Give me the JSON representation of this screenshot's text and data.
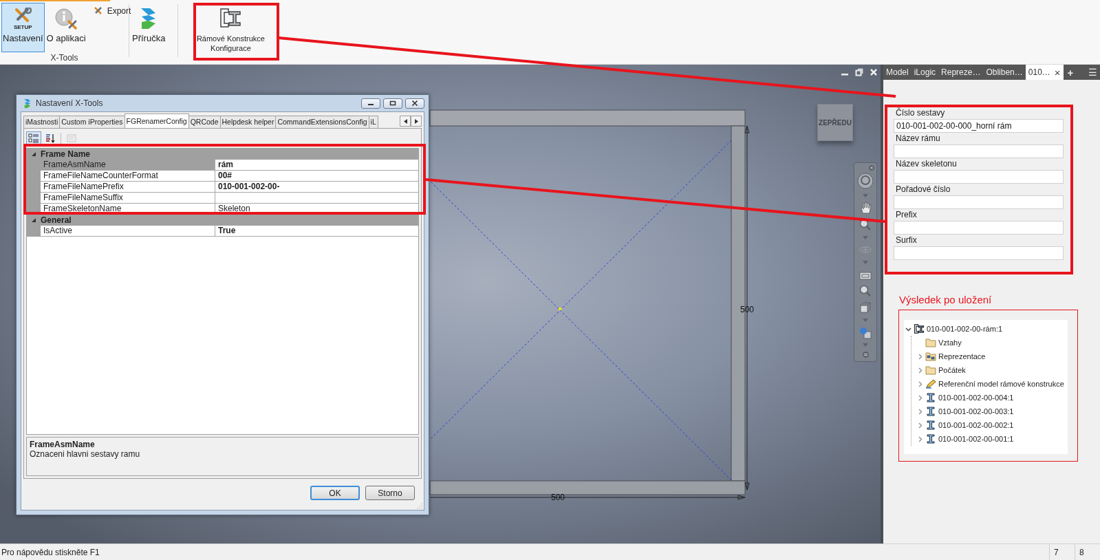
{
  "ribbon": {
    "groups": [
      {
        "label": "X-Tools",
        "buttons": [
          {
            "label": "Nastavení",
            "kind": "setup",
            "icon_caption": "SETUP",
            "selected": true
          },
          {
            "label": "O aplikaci",
            "kind": "about",
            "selected": false
          },
          {
            "label": "Export",
            "kind": "export",
            "selected": false
          }
        ]
      },
      {
        "buttons": [
          {
            "label": "Příručka",
            "kind": "manual",
            "selected": false
          }
        ]
      },
      {
        "buttons": [
          {
            "label": "Rámové Konstrukce Konfigurace",
            "kind": "frame",
            "selected": false
          }
        ]
      }
    ]
  },
  "viewport": {
    "view_cube": "ZEPŘEDU",
    "dimensions": {
      "vertical": "500",
      "horizontal": "500"
    }
  },
  "dialog": {
    "title": "Nastavení X-Tools",
    "tabs": [
      {
        "label": "iMastnosti",
        "selected": false
      },
      {
        "label": "Custom iProperties",
        "selected": false
      },
      {
        "label": "FGRenamerConfig",
        "selected": true
      },
      {
        "label": "QRCode",
        "selected": false
      },
      {
        "label": "Helpdesk helper",
        "selected": false
      },
      {
        "label": "CommandExtensionsConfig",
        "selected": false
      },
      {
        "label": "iL",
        "selected": false
      }
    ],
    "categories": [
      {
        "name": "Frame Name",
        "expanded": true,
        "properties": [
          {
            "name": "FrameAsmName",
            "value": "rám",
            "modified": true,
            "selected": true
          },
          {
            "name": "FrameFileNameCounterFormat",
            "value": "00#",
            "modified": true,
            "selected": false
          },
          {
            "name": "FrameFileNamePrefix",
            "value": "010-001-002-00-",
            "modified": true,
            "selected": false
          },
          {
            "name": "FrameFileNameSuffix",
            "modified": false,
            "selected": false
          },
          {
            "name": "FrameSkeletonName",
            "value": "Skeleton",
            "modified": false,
            "selected": false
          }
        ]
      },
      {
        "name": "General",
        "expanded": true,
        "properties": [
          {
            "name": "IsActive",
            "value": "True",
            "modified": true,
            "selected": false
          }
        ]
      }
    ],
    "description": {
      "title": "FrameAsmName",
      "text": "Oznaceni hlavni sestavy ramu"
    },
    "buttons": [
      {
        "label": "OK",
        "default": true
      },
      {
        "label": "Storno",
        "default": false
      }
    ]
  },
  "side_panel": {
    "tabs": [
      {
        "label": "Model",
        "selected": false
      },
      {
        "label": "iLogic",
        "selected": false
      },
      {
        "label": "Repreze…",
        "selected": false
      },
      {
        "label": "Obliben…",
        "selected": false
      },
      {
        "label": "010…",
        "selected": true,
        "close": "×"
      }
    ],
    "add": "+",
    "menu": "☰",
    "fields": [
      {
        "label": "Číslo sestavy",
        "value": "010-001-002-00-000_horní rám"
      },
      {
        "label": "Název rámu"
      },
      {
        "label": "Název skeletonu"
      },
      {
        "label": "Pořadové číslo"
      },
      {
        "label": "Prefix"
      },
      {
        "label": "Surfix"
      }
    ],
    "result": {
      "title": "Výsledek po uložení",
      "tree": [
        {
          "label": "010-001-002-00-rám:1",
          "kind": "frame",
          "expanded": true,
          "children": [
            {
              "label": "Vztahy",
              "kind": "folder",
              "expandable": false
            },
            {
              "label": "Reprezentace",
              "kind": "representations",
              "expandable": true
            },
            {
              "label": "Počátek",
              "kind": "folder",
              "expandable": true
            },
            {
              "label": "Referenční model rámové konstrukce",
              "kind": "reference",
              "expandable": true
            },
            {
              "label": "010-001-002-00-004:1",
              "kind": "beam",
              "expandable": true
            },
            {
              "label": "010-001-002-00-003:1",
              "kind": "beam",
              "expandable": true
            },
            {
              "label": "010-001-002-00-002:1",
              "kind": "beam",
              "expandable": true
            },
            {
              "label": "010-001-002-00-001:1",
              "kind": "beam",
              "expandable": true
            }
          ]
        }
      ]
    }
  },
  "status_bar": {
    "text": "Pro nápovědu stiskněte F1",
    "cells": [
      "7",
      "8"
    ]
  }
}
